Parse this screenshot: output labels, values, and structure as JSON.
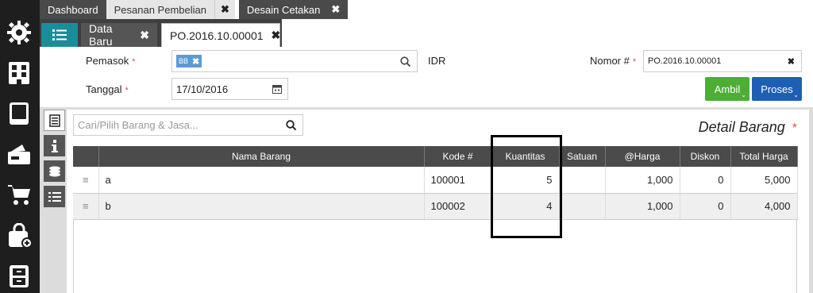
{
  "top_tabs": [
    {
      "label": "Dashboard"
    },
    {
      "label": "Pesanan Pembelian"
    },
    {
      "label": "Desain Cetakan"
    }
  ],
  "close_glyph": "✖",
  "sub_tabs": {
    "data_baru": "Data Baru",
    "po": "PO.2016.10.00001"
  },
  "form": {
    "pemasok_label": "Pemasok",
    "pemasok_chip": "BB",
    "currency": "IDR",
    "tanggal_label": "Tanggal",
    "tanggal_value": "17/10/2016",
    "nomor_label": "Nomor #",
    "nomor_value": "PO.2016.10.00001",
    "required_mark": "*"
  },
  "buttons": {
    "ambil": "Ambil",
    "proses": "Proses"
  },
  "search": {
    "placeholder": "Cari/Pilih Barang & Jasa..."
  },
  "detail_title": "Detail Barang",
  "table": {
    "headers": [
      "Nama Barang",
      "Kode #",
      "Kuantitas",
      "Satuan",
      "@Harga",
      "Diskon",
      "Total Harga"
    ],
    "rows": [
      {
        "nama": "a",
        "kode": "100001",
        "kuantitas": "5",
        "satuan": "",
        "harga": "1,000",
        "diskon": "0",
        "total": "5,000"
      },
      {
        "nama": "b",
        "kode": "100002",
        "kuantitas": "4",
        "satuan": "",
        "harga": "1,000",
        "diskon": "0",
        "total": "4,000"
      }
    ]
  },
  "colors": {
    "teal": "#1a8d9a",
    "green": "#4cae33",
    "blue": "#1d5fb4",
    "required": "#d9534f"
  },
  "icons": {
    "sidebar": [
      "settings-gear-icon",
      "building-icon",
      "book-icon",
      "wallet-icon",
      "cart-icon",
      "bag-add-icon",
      "cabinet-icon"
    ]
  }
}
